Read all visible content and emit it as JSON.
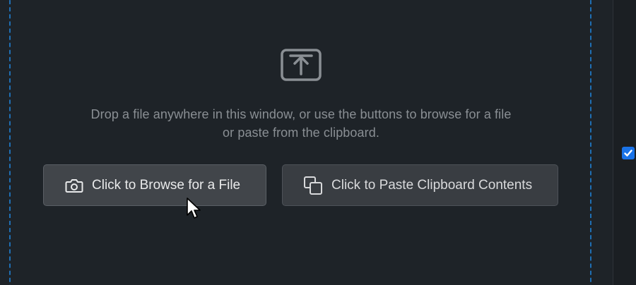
{
  "drop_zone": {
    "hint_line1": "Drop a file anywhere in this window, or use the buttons to browse for a file",
    "hint_line2": "or paste from the clipboard.",
    "upload_icon": "upload-icon"
  },
  "buttons": {
    "browse_label": "Click to Browse for a File",
    "browse_icon": "camera-icon",
    "paste_label": "Click to Paste Clipboard Contents",
    "paste_icon": "copy-icon"
  },
  "side_panel": {
    "checkbox_checked": true
  },
  "colors": {
    "background": "#1e2328",
    "dashed_border": "#1f6fb4",
    "hint_text": "#8a8f94",
    "button_bg": "#41454a",
    "checkbox_accent": "#1a73e8"
  }
}
